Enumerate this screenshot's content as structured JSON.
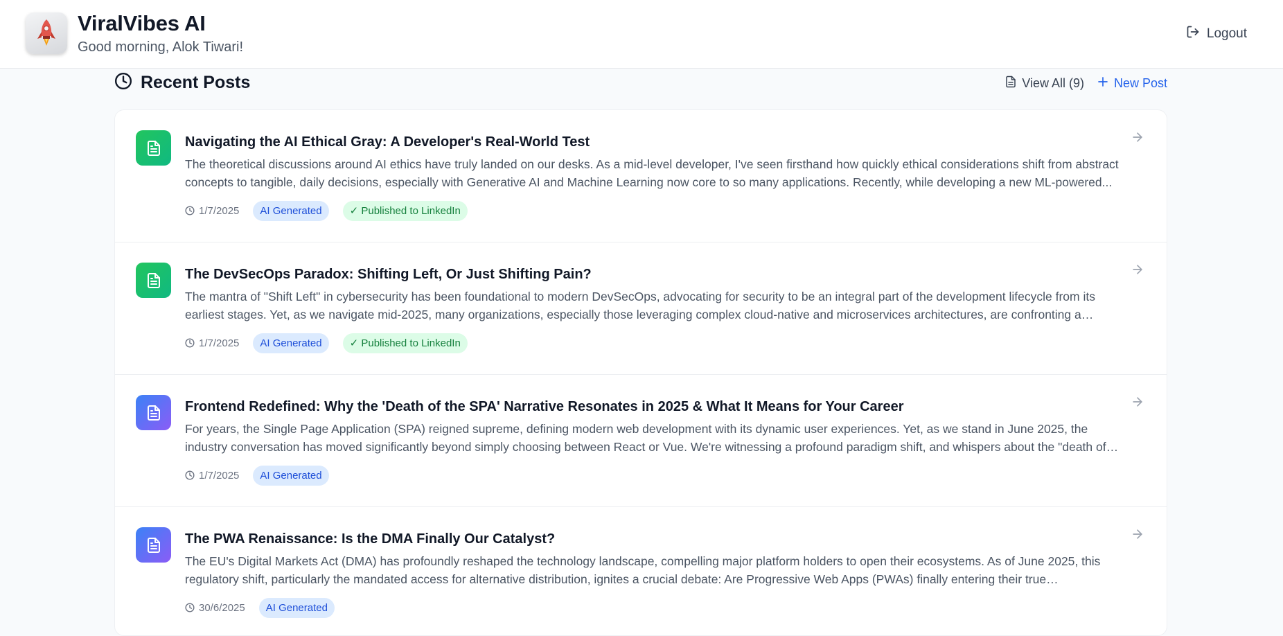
{
  "header": {
    "app_title": "ViralVibes AI",
    "greeting": "Good morning, Alok Tiwari!",
    "logout_label": "Logout"
  },
  "section": {
    "title": "Recent Posts",
    "view_all_label": "View All (9)",
    "new_post_label": "New Post"
  },
  "colors": {
    "accent_blue": "#2563eb",
    "green_icon": "#22c55e",
    "purple_icon": "#6366f1",
    "ai_badge_bg": "#dbeafe",
    "published_badge_bg": "#dcfce7"
  },
  "posts": [
    {
      "title": "Navigating the AI Ethical Gray: A Developer's Real-World Test",
      "excerpt": "The theoretical discussions around AI ethics have truly landed on our desks. As a mid-level developer, I've seen firsthand how quickly ethical considerations shift from abstract concepts to tangible, daily decisions, especially with Generative AI and Machine Learning now core to so many applications. Recently, while developing a new ML-powered...",
      "date": "1/7/2025",
      "ai_badge": "AI Generated",
      "published_badge": "✓ Published to LinkedIn",
      "icon": "document-icon",
      "icon_color": "green"
    },
    {
      "title": "The DevSecOps Paradox: Shifting Left, Or Just Shifting Pain?",
      "excerpt": "The mantra of \"Shift Left\" in cybersecurity has been foundational to modern DevSecOps, advocating for security to be an integral part of the development lifecycle from its earliest stages. Yet, as we navigate mid-2025, many organizations, especially those leveraging complex cloud-native and microservices architectures, are confronting a curiou...",
      "date": "1/7/2025",
      "ai_badge": "AI Generated",
      "published_badge": "✓ Published to LinkedIn",
      "icon": "document-icon",
      "icon_color": "green"
    },
    {
      "title": "Frontend Redefined: Why the 'Death of the SPA' Narrative Resonates in 2025 & What It Means for Your Career",
      "excerpt": "For years, the Single Page Application (SPA) reigned supreme, defining modern web development with its dynamic user experiences. Yet, as we stand in June 2025, the industry conversation has moved significantly beyond simply choosing between React or Vue. We're witnessing a profound paradigm shift, and whispers about the \"death of the SPA\"...",
      "date": "1/7/2025",
      "ai_badge": "AI Generated",
      "icon": "document-icon",
      "icon_color": "purple"
    },
    {
      "title": "The PWA Renaissance: Is the DMA Finally Our Catalyst?",
      "excerpt": "The EU's Digital Markets Act (DMA) has profoundly reshaped the technology landscape, compelling major platform holders to open their ecosystems. As of June 2025, this regulatory shift, particularly the mandated access for alternative distribution, ignites a crucial debate: Are Progressive Web Apps (PWAs) finally entering their true renaissance...",
      "date": "30/6/2025",
      "ai_badge": "AI Generated",
      "icon": "document-icon",
      "icon_color": "purple"
    }
  ]
}
